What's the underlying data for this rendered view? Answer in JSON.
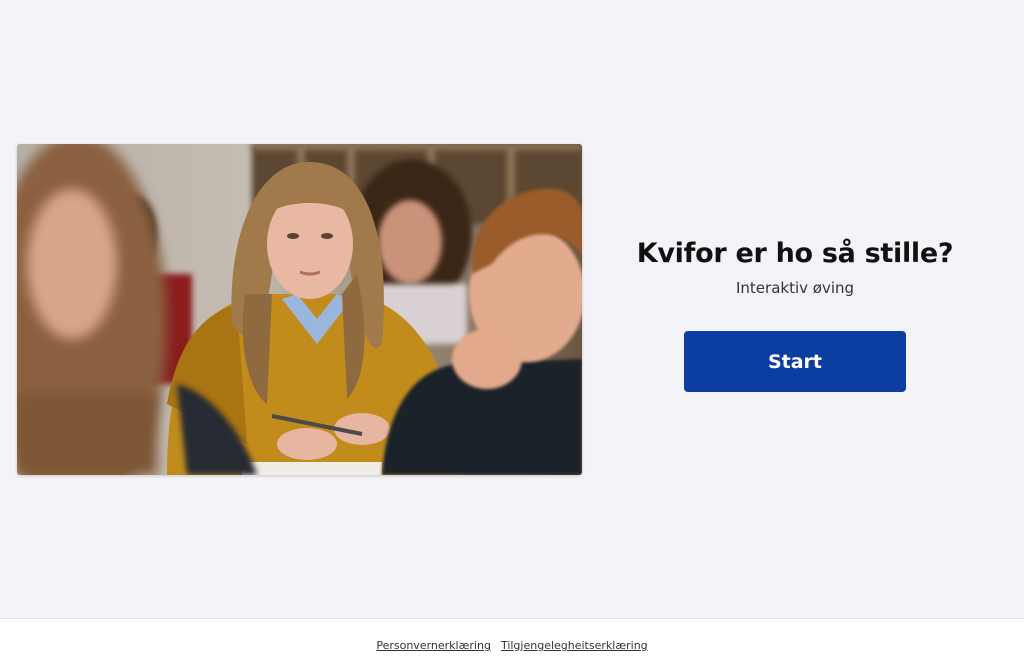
{
  "intro": {
    "title": "Kvifor er ho så stille?",
    "subtitle": "Interaktiv øving",
    "start_label": "Start"
  },
  "footer": {
    "links": [
      "Personvernerklæring",
      "Tilgjengelegheitserklæring"
    ]
  },
  "colors": {
    "background": "#f3f3f8",
    "button": "#0b3ea0",
    "button_text": "#ffffff",
    "footer_background": "#ffffff"
  }
}
